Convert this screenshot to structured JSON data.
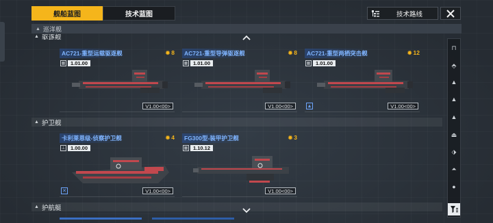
{
  "tabs": [
    {
      "label": "舰船蓝图",
      "active": true
    },
    {
      "label": "技术蓝图",
      "active": false
    }
  ],
  "tech_route": {
    "label": "技术路线",
    "icon": "tree-icon"
  },
  "close": {
    "icon": "close-icon"
  },
  "category_header": {
    "label": "巡洋舰",
    "icon": "cruiser-icon"
  },
  "sections": [
    {
      "label": "驱逐舰"
    },
    {
      "label": "护卫舰"
    },
    {
      "label": "护航艇"
    }
  ],
  "destroyer_cards": [
    {
      "name": "AC721-重型运载驱逐舰",
      "cost": "8",
      "stat": "1.01.00",
      "version": "V1.00<00>",
      "tagged": false
    },
    {
      "name": "AC721-重型导弹驱逐舰",
      "cost": "8",
      "stat": "1.01.00",
      "version": "V1.00<00>",
      "tagged": false
    },
    {
      "name": "AC721-重型两栖突击舰",
      "cost": "12",
      "stat": "1.01.00",
      "version": "V1.00<00>",
      "tagged": true
    }
  ],
  "frigate_cards": [
    {
      "name": "卡利莱恩级-侦察护卫舰",
      "cost": "4",
      "stat": "1.00.00",
      "version": "V1.00<00>",
      "tagged": true
    },
    {
      "name": "FG300型-装甲护卫舰",
      "cost": "3",
      "stat": "1.10.12",
      "version": "V1.00<00>",
      "tagged": false
    }
  ],
  "sidebar_icons": [
    "frigate-class-icon",
    "destroyer-class-icon",
    "cruiser-class-icon",
    "battlecruiser-class-icon",
    "carrier-class-icon",
    "auxiliary-class-icon",
    "escort-class-icon",
    "corvette-class-icon",
    "capital-class-icon"
  ],
  "colors": {
    "accent": "#f5b51b",
    "name_blue": "#7fb4ff",
    "ship_red": "#c2484e"
  }
}
